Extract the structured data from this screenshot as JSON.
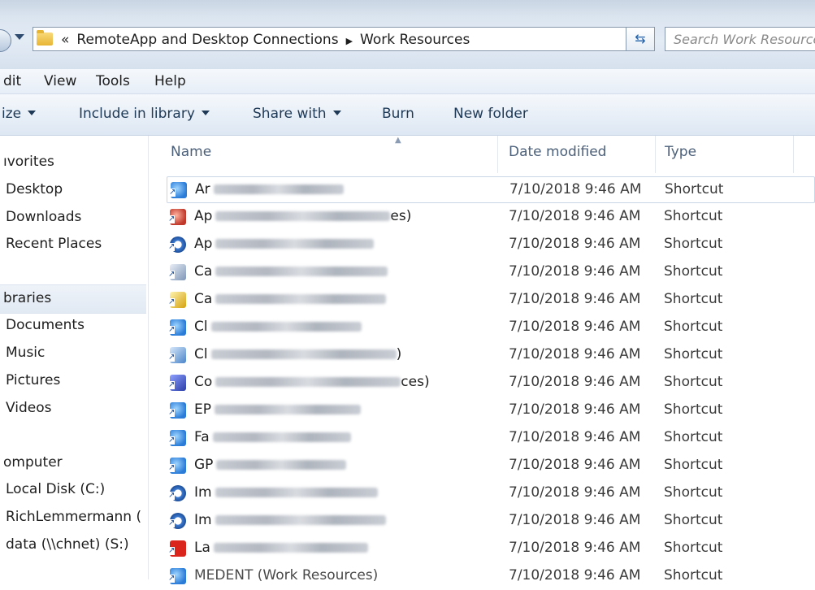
{
  "address_bar": {
    "chevron": "«",
    "breadcrumb": [
      "RemoteApp and Desktop Connections",
      "▶",
      "Work Resources"
    ],
    "search_placeholder": "Search Work Resources"
  },
  "menu": [
    "dit",
    "View",
    "Tools",
    "Help"
  ],
  "commands": {
    "organize": "ize",
    "include_in_library": "Include in library",
    "share_with": "Share with",
    "burn": "Burn",
    "new_folder": "New folder"
  },
  "nav": {
    "favorites_header": "ıvorites",
    "favorites": [
      "Desktop",
      "Downloads",
      "Recent Places"
    ],
    "libraries_header": "braries",
    "libraries": [
      "Documents",
      "Music",
      "Pictures",
      "Videos"
    ],
    "computer_header": "omputer",
    "drives": [
      "Local Disk (C:)",
      "RichLemmermann (",
      "data (\\\\chnet) (S:)"
    ]
  },
  "columns": {
    "name": "Name",
    "date": "Date modified",
    "type": "Type"
  },
  "files": [
    {
      "icon": "rdp-shortcut-icon",
      "prefix": "Ar",
      "suffix": "",
      "date": "7/10/2018 9:46 AM",
      "type": "Shortcut"
    },
    {
      "icon": "remote-app-icon",
      "prefix": "Ap",
      "suffix": "es)",
      "date": "7/10/2018 9:46 AM",
      "type": "Shortcut"
    },
    {
      "icon": "disc-app-icon",
      "prefix": "Ap",
      "suffix": "",
      "date": "7/10/2018 9:46 AM",
      "type": "Shortcut"
    },
    {
      "icon": "window-app-icon",
      "prefix": "Ca",
      "suffix": "",
      "date": "7/10/2018 9:46 AM",
      "type": "Shortcut"
    },
    {
      "icon": "key-app-icon",
      "prefix": "Ca",
      "suffix": "",
      "date": "7/10/2018 9:46 AM",
      "type": "Shortcut"
    },
    {
      "icon": "rdp-shortcut-icon",
      "prefix": "Cl",
      "suffix": "",
      "date": "7/10/2018 9:46 AM",
      "type": "Shortcut"
    },
    {
      "icon": "chart-app-icon",
      "prefix": "Cl",
      "suffix": ")",
      "date": "7/10/2018 9:46 AM",
      "type": "Shortcut"
    },
    {
      "icon": "blue-app-icon",
      "prefix": "Co",
      "suffix": "ces)",
      "date": "7/10/2018 9:46 AM",
      "type": "Shortcut"
    },
    {
      "icon": "rdp-shortcut-icon",
      "prefix": "EP",
      "suffix": "",
      "date": "7/10/2018 9:46 AM",
      "type": "Shortcut"
    },
    {
      "icon": "rdp-shortcut-icon",
      "prefix": "Fa",
      "suffix": "",
      "date": "7/10/2018 9:46 AM",
      "type": "Shortcut"
    },
    {
      "icon": "rdp-shortcut-icon",
      "prefix": "GP",
      "suffix": "",
      "date": "7/10/2018 9:46 AM",
      "type": "Shortcut"
    },
    {
      "icon": "disc-app-icon",
      "prefix": "Im",
      "suffix": "",
      "date": "7/10/2018 9:46 AM",
      "type": "Shortcut"
    },
    {
      "icon": "disc-app-icon",
      "prefix": "Im",
      "suffix": "",
      "date": "7/10/2018 9:46 AM",
      "type": "Shortcut"
    },
    {
      "icon": "red-app-icon",
      "prefix": "La",
      "suffix": "",
      "date": "7/10/2018 9:46 AM",
      "type": "Shortcut"
    },
    {
      "icon": "rdp-shortcut-icon",
      "prefix": "MEDENT (Work Resources)",
      "suffix": "",
      "date": "7/10/2018 9:46 AM",
      "type": "Shortcut"
    }
  ]
}
